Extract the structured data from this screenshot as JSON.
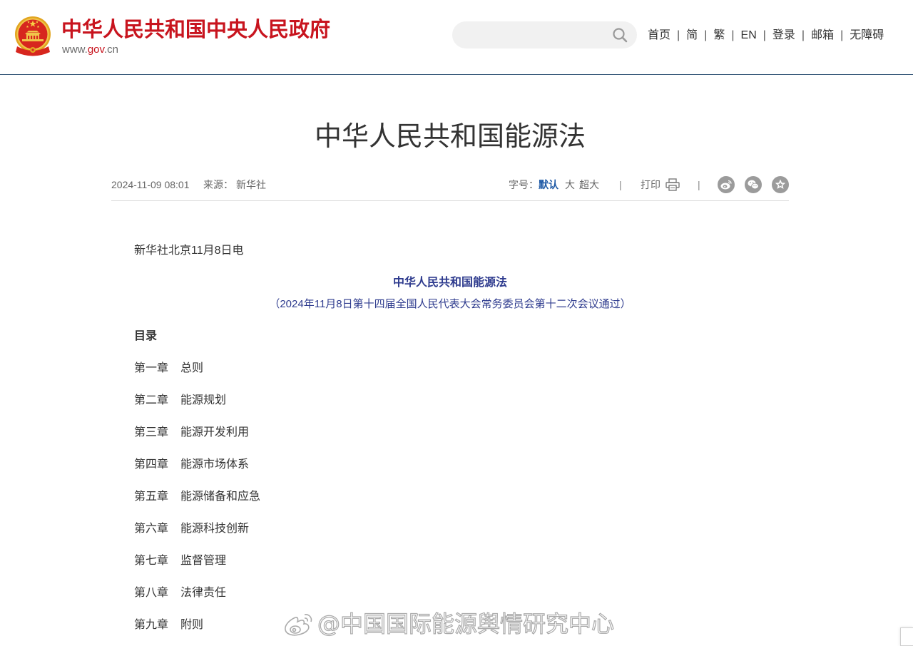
{
  "header": {
    "site_title": "中华人民共和国中央人民政府",
    "site_url": {
      "prefix": "www.",
      "domain": "gov",
      "suffix": ".cn"
    },
    "emblem_icon": "national-emblem",
    "search": {
      "placeholder": "",
      "icon": "search-icon"
    },
    "nav": [
      "首页",
      "简",
      "繁",
      "EN",
      "登录",
      "邮箱",
      "无障碍"
    ],
    "nav_separator": "|"
  },
  "article": {
    "title": "中华人民共和国能源法",
    "meta": {
      "datetime": "2024-11-09 08:01",
      "source_label": "来源：",
      "source": "新华社",
      "font_size_label": "字号：",
      "font_size_options": [
        {
          "label": "默认",
          "selected": true
        },
        {
          "label": "大",
          "selected": false
        },
        {
          "label": "超大",
          "selected": false
        }
      ],
      "separator": "|",
      "print_label": "打印",
      "print_icon": "printer-icon",
      "share": [
        {
          "icon": "weibo-icon"
        },
        {
          "icon": "wechat-icon"
        },
        {
          "icon": "favorite-icon"
        }
      ]
    },
    "body": {
      "dateline": "新华社北京11月8日电",
      "law_title": "中华人民共和国能源法",
      "law_subtitle": "（2024年11月8日第十四届全国人民代表大会常务委员会第十二次会议通过）",
      "toc_heading": "目录",
      "toc": [
        {
          "chapter": "第一章",
          "title": "总则"
        },
        {
          "chapter": "第二章",
          "title": "能源规划"
        },
        {
          "chapter": "第三章",
          "title": "能源开发利用"
        },
        {
          "chapter": "第四章",
          "title": "能源市场体系"
        },
        {
          "chapter": "第五章",
          "title": "能源储备和应急"
        },
        {
          "chapter": "第六章",
          "title": "能源科技创新"
        },
        {
          "chapter": "第七章",
          "title": "监督管理"
        },
        {
          "chapter": "第八章",
          "title": "法律责任"
        },
        {
          "chapter": "第九章",
          "title": "附则"
        }
      ]
    }
  },
  "watermark": {
    "text": "@中国国际能源舆情研究中心",
    "icon": "weibo-logo-icon"
  },
  "colors": {
    "brand_red": "#c8141e",
    "header_rule": "#3b5b7c",
    "link_blue": "#1f5aa6",
    "law_title_blue": "#2e3b8e",
    "text": "#333333",
    "meta_text": "#666666",
    "share_icon_bg": "#9b9b9b"
  }
}
